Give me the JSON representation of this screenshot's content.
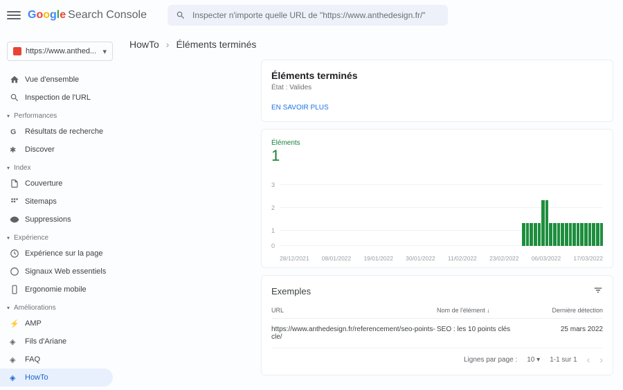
{
  "header": {
    "search_placeholder": "Inspecter n'importe quelle URL de \"https://www.anthedesign.fr/\""
  },
  "domain": "https://www.anthed...",
  "sidebar": {
    "top": [
      {
        "label": "Vue d'ensemble"
      },
      {
        "label": "Inspection de l'URL"
      }
    ],
    "sections": [
      {
        "title": "Performances",
        "items": [
          {
            "label": "Résultats de recherche"
          },
          {
            "label": "Discover"
          }
        ]
      },
      {
        "title": "Index",
        "items": [
          {
            "label": "Couverture"
          },
          {
            "label": "Sitemaps"
          },
          {
            "label": "Suppressions"
          }
        ]
      },
      {
        "title": "Expérience",
        "items": [
          {
            "label": "Expérience sur la page"
          },
          {
            "label": "Signaux Web essentiels"
          },
          {
            "label": "Ergonomie mobile"
          }
        ]
      },
      {
        "title": "Améliorations",
        "items": [
          {
            "label": "AMP"
          },
          {
            "label": "Fils d'Ariane"
          },
          {
            "label": "FAQ"
          },
          {
            "label": "HowTo"
          }
        ]
      }
    ]
  },
  "breadcrumb": {
    "parent": "HowTo",
    "current": "Éléments terminés"
  },
  "header_card": {
    "title": "Éléments terminés",
    "state": "État : Valides",
    "link": "EN SAVOIR PLUS"
  },
  "chart": {
    "metric_label": "Éléments",
    "metric_value": "1"
  },
  "chart_data": {
    "type": "bar",
    "title": "Éléments",
    "ylabel": "",
    "xlabel": "",
    "ylim": [
      0,
      3
    ],
    "categories": [
      "28/12/2021",
      "08/01/2022",
      "19/01/2022",
      "30/01/2022",
      "11/02/2022",
      "23/02/2022",
      "06/03/2022",
      "17/03/2022"
    ],
    "values_daily": [
      1,
      1,
      1,
      1,
      1,
      2,
      2,
      1,
      1,
      1,
      1,
      1,
      1,
      1,
      1,
      1,
      1,
      1,
      1,
      1,
      1
    ]
  },
  "examples": {
    "title": "Exemples",
    "cols": {
      "url": "URL",
      "name": "Nom de l'élément",
      "date": "Dernière détection"
    },
    "rows": [
      {
        "url": "https://www.anthedesign.fr/referencement/seo-points-cle/",
        "name": "SEO : les 10 points clés",
        "date": "25 mars 2022"
      }
    ],
    "pager": {
      "rpp_label": "Lignes par page :",
      "rpp": "10",
      "range": "1-1 sur 1"
    }
  }
}
